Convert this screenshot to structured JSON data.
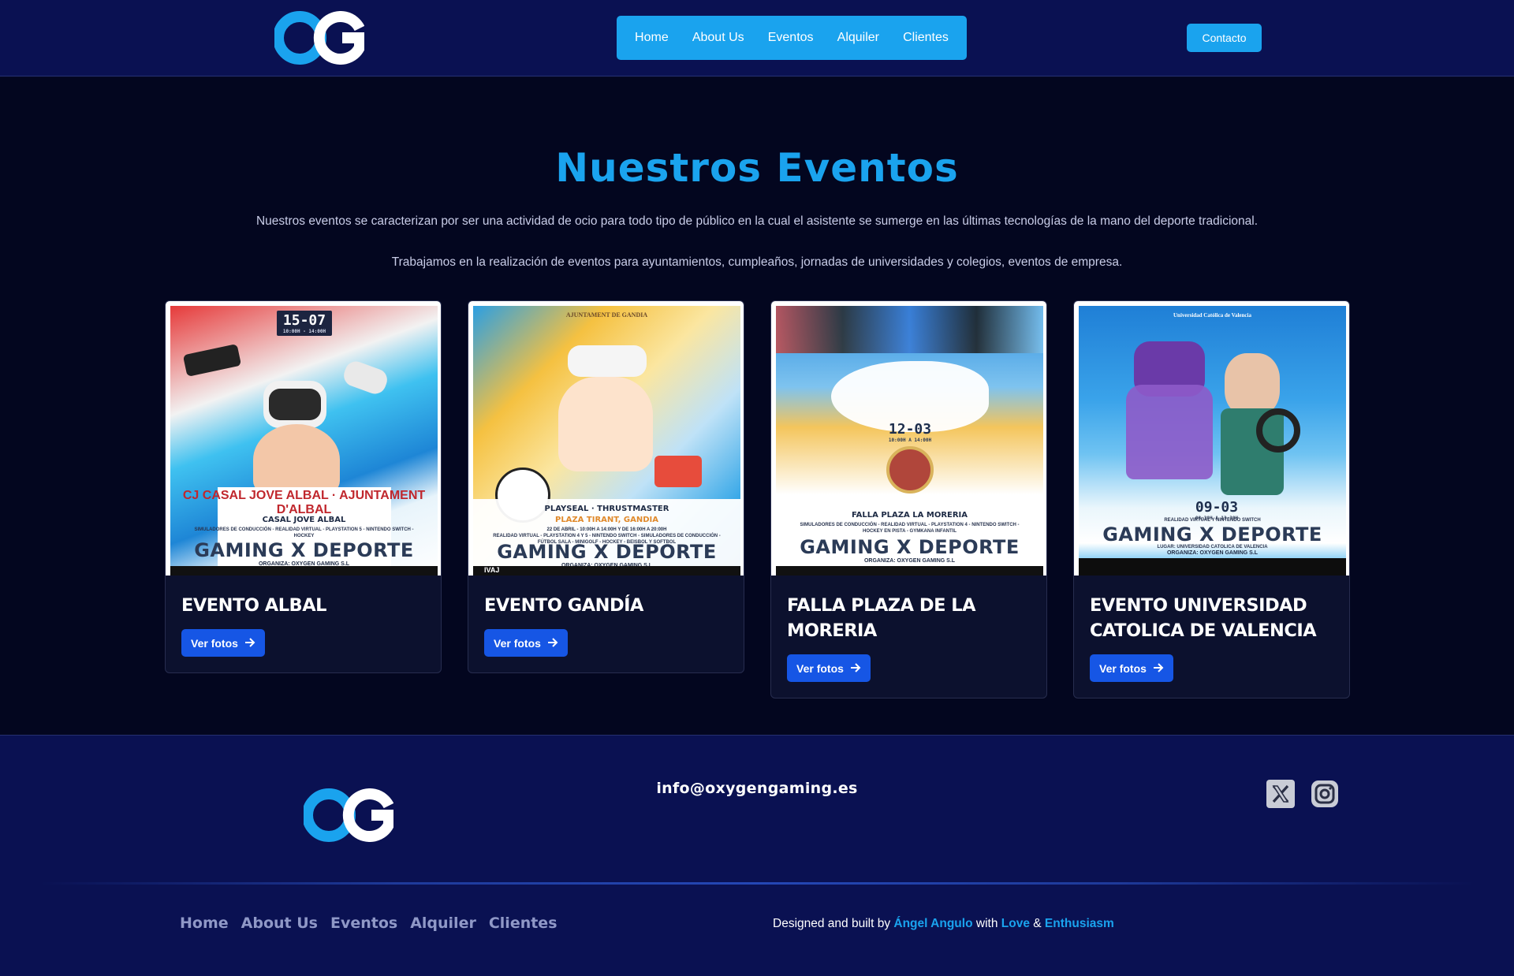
{
  "header": {
    "logo_alt": "OG",
    "nav": [
      "Home",
      "About Us",
      "Eventos",
      "Alquiler",
      "Clientes"
    ],
    "contact_label": "Contacto"
  },
  "main": {
    "title": "Nuestros Eventos",
    "intro_1": "Nuestros eventos se caracterizan por ser una actividad de ocio para todo tipo de público en la cual el asistente se sumerge en las últimas tecnologías de la mano del deporte tradicional.",
    "intro_2": "Trabajamos en la realización de eventos para ayuntamientos, cumpleaños, jornadas de universidades y colegios, eventos de empresa.",
    "button_label": "Ver fotos",
    "cards": [
      {
        "title": "EVENTO ALBAL",
        "poster": {
          "date": "15-07",
          "time": "10:00H - 14:00H",
          "location": "CASAL JOVE ALBAL",
          "details": "SIMULADORES DE CONDUCCIÓN - REALIDAD VIRTUAL - PLAYSTATION 5 - NINTENDO SWITCH - HOCKEY",
          "brand": "GAMING X DEPORTE",
          "organiza": "ORGANIZA: OXYGEN GAMING S.L"
        }
      },
      {
        "title": "EVENTO GANDÍA",
        "poster": {
          "header": "AJUNTAMENT DE GANDIA",
          "location": "PLAZA TIRANT, GANDIA",
          "date_line": "22 DE ABRIL - 10:00H A 14:00H Y DE 16:00H A 20:00H",
          "details": "REALIDAD VIRTUAL - PLAYSTATION 4 Y 5 - NINTENDO SWITCH - SIMULADORES DE CONDUCCIÓN - FÚTBOL SALA - MINIGOLF - HOCKEY - BEISBOL Y SOFTBOL",
          "brand": "GAMING X DEPORTE",
          "organiza": "ORGANIZA: OXYGEN GAMING S.L",
          "footer_logo": "IVAJ"
        }
      },
      {
        "title": "FALLA PLAZA DE LA MORERIA",
        "poster": {
          "date": "12-03",
          "time": "10:00H A 14:00H",
          "location": "FALLA PLAZA LA MORERIA",
          "details": "SIMULADORES DE CONDUCCIÓN - REALIDAD VIRTUAL - PLAYSTATION 4 - NINTENDO SWITCH - HOCKEY EN PISTA - GYMKANA INFANTIL",
          "brand": "GAMING X DEPORTE",
          "organiza": "ORGANIZA: OXYGEN GAMING S.L"
        }
      },
      {
        "title": "EVENTO UNIVERSIDAD CATOLICA DE VALENCIA",
        "poster": {
          "header": "Universidad Católica de Valencia",
          "date": "09-03",
          "time": "08:30H A 13:30H",
          "details": "REALIDAD VIRTUAL Y NINTENDO SWITCH",
          "brand": "GAMING X DEPORTE",
          "location": "LUGAR: UNIVERSIDAD CATOLICA DE VALENCIA",
          "organiza": "ORGANIZA: OXYGEN GAMING S.L"
        }
      }
    ]
  },
  "footer": {
    "email": "info@oxygengaming.es",
    "nav": [
      "Home",
      "About Us",
      "Eventos",
      "Alquiler",
      "Clientes"
    ],
    "credits": {
      "prefix": "Designed and built by",
      "author": "Ángel Angulo",
      "with": "with",
      "love": "Love",
      "amp": "&",
      "enthusiasm": "Enthusiasm"
    },
    "social_icons": [
      "x-icon",
      "instagram-icon"
    ]
  },
  "colors": {
    "accent": "#1aa3ee",
    "button": "#1656e5",
    "header_bg": "#0a1152",
    "main_bg": "#03061f"
  }
}
